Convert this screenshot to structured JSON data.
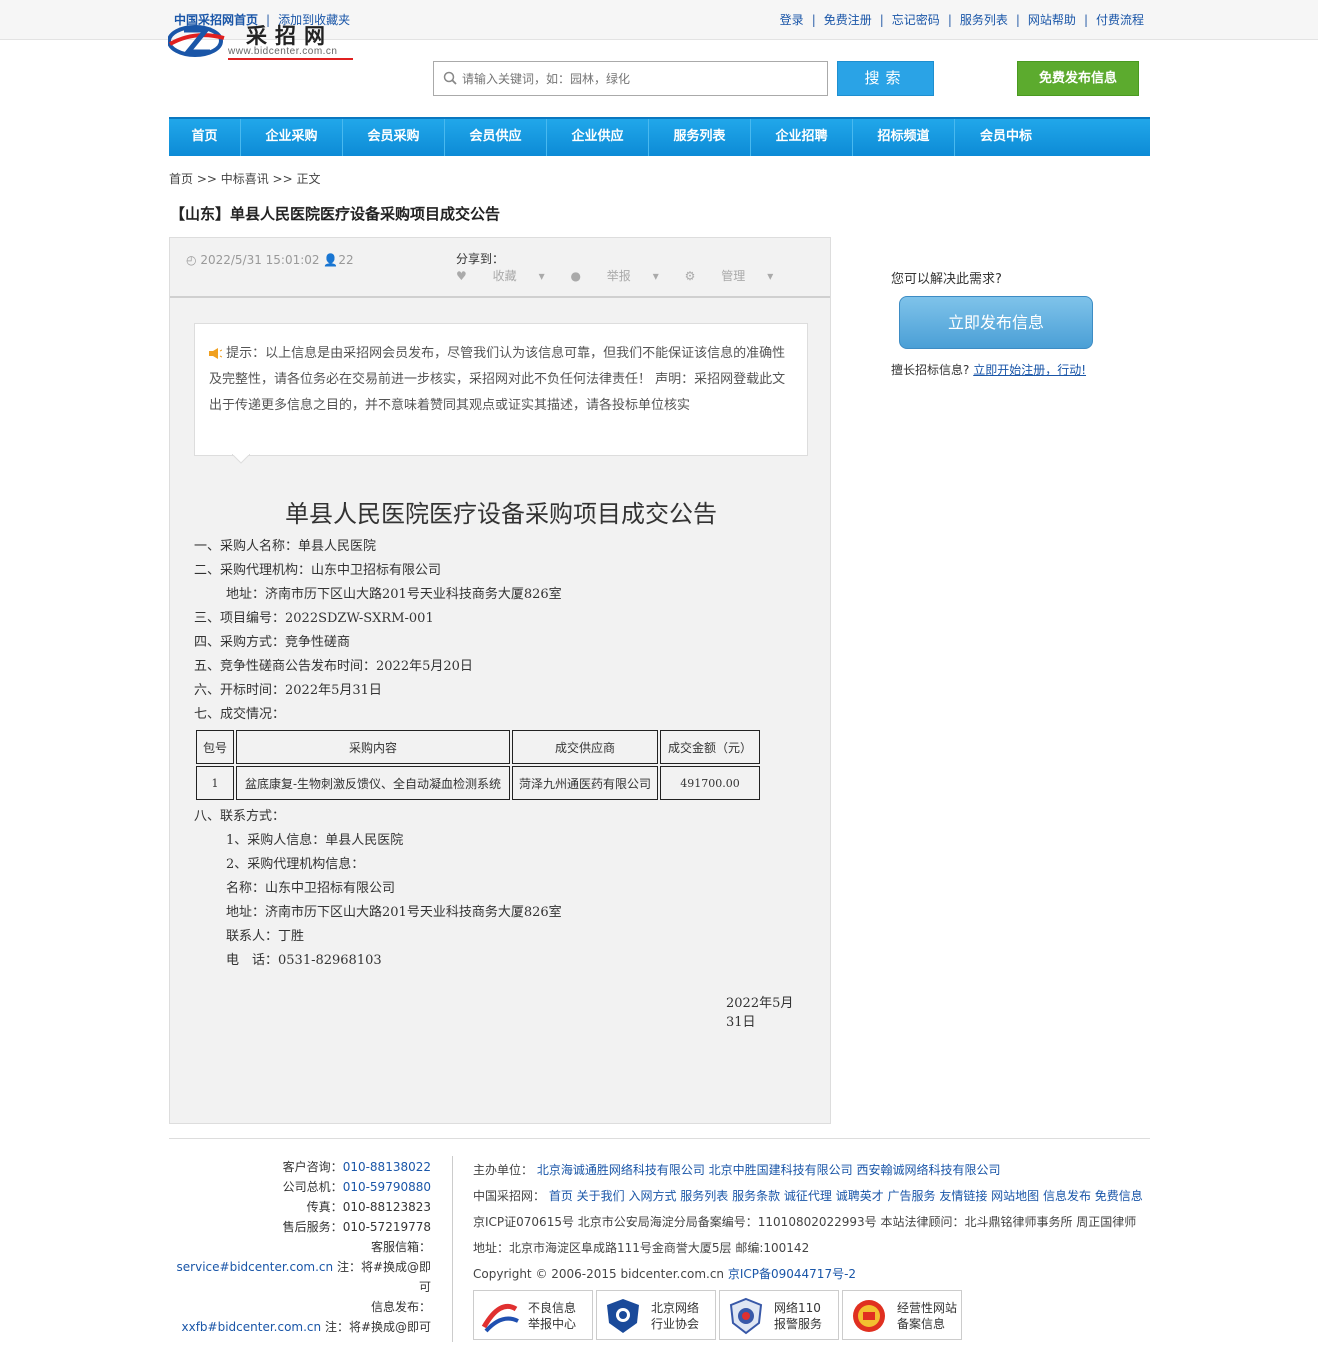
{
  "topbar": {
    "home": "中国采招网首页",
    "fav": "添加到收藏夹",
    "links": [
      "登录",
      "免费注册",
      "忘记密码",
      "服务列表",
      "网站帮助",
      "付费流程"
    ]
  },
  "logo": {
    "title": "采招网",
    "url": "www.bidcenter.com.cn"
  },
  "search": {
    "placeholder": "请输入关键词，如：园林，绿化",
    "button": "搜索"
  },
  "publish_button": "免费发布信息",
  "nav": [
    "首页",
    "企业采购",
    "会员采购",
    "会员供应",
    "企业供应",
    "服务列表",
    "企业招聘",
    "招标频道",
    "会员中标"
  ],
  "breadcrumb": "首页 >> 中标喜讯 >> 正文",
  "title": "【山东】单县人民医院医疗设备采购项目成交公告",
  "meta": {
    "datetime": "2022/5/31 15:01:02",
    "views": "22",
    "share_label": "分享到：",
    "actions": [
      "收藏",
      "举报",
      "管理"
    ]
  },
  "notice": "提示：以上信息是由采招网会员发布，尽管我们认为该信息可靠，但我们不能保证该信息的准确性及完整性，请各位务必在交易前进一步核实，采招网对此不负任何法律责任！ 声明：采招网登载此文出于传递更多信息之目的，并不意味着赞同其观点或证实其描述，请各投标单位核实",
  "article": {
    "heading": "单县人民医院医疗设备采购项目成交公告",
    "lines": [
      {
        "t": "一、采购人名称：单县人民医院",
        "ind": false
      },
      {
        "t": "二、采购代理机构：山东中卫招标有限公司",
        "ind": false
      },
      {
        "t": "地址：济南市历下区山大路201号天业科技商务大厦826室",
        "ind": true
      },
      {
        "t": "三、项目编号：2022SDZW-SXRM-001",
        "ind": false
      },
      {
        "t": "四、采购方式：竞争性磋商",
        "ind": false
      },
      {
        "t": "五、竞争性磋商公告发布时间：2022年5月20日",
        "ind": false
      },
      {
        "t": "六、开标时间：2022年5月31日",
        "ind": false
      },
      {
        "t": "七、成交情况：",
        "ind": false
      }
    ],
    "table": {
      "headers": [
        "包号",
        "采购内容",
        "成交供应商",
        "成交金额（元）"
      ],
      "rows": [
        [
          "1",
          "盆底康复-生物刺激反馈仪、全自动凝血检测系统",
          "菏泽九州通医药有限公司",
          "491700.00"
        ]
      ]
    },
    "lines2": [
      {
        "t": "八、联系方式：",
        "ind": false
      },
      {
        "t": "1、采购人信息：单县人民医院",
        "ind": true
      },
      {
        "t": "2、采购代理机构信息：",
        "ind": true
      },
      {
        "t": "名称：山东中卫招标有限公司",
        "ind": true
      },
      {
        "t": "地址：济南市历下区山大路201号天业科技商务大厦826室",
        "ind": true
      },
      {
        "t": "联系人：丁胜",
        "ind": true
      },
      {
        "t": "电　话：0531-82968103",
        "ind": true
      }
    ],
    "date": "2022年5月31日"
  },
  "side": {
    "question": "您可以解决此需求?",
    "button": "立即发布信息",
    "reg_text": "擅长招标信息?",
    "reg_link": "立即开始注册，行动!"
  },
  "footer_left": [
    {
      "k": "客户咨询：",
      "v": "010-88138022"
    },
    {
      "k": "公司总机：",
      "v": "010-59790880"
    },
    {
      "k": "传真：",
      "v": "010-88123823"
    },
    {
      "k": "售后服务：",
      "v": "010-57219778"
    },
    {
      "k": "客服信箱：",
      "v": ""
    },
    {
      "k": "",
      "v": "service#bidcenter.com.cn",
      "n": " 注：将#换成@即可"
    },
    {
      "k": "信息发布：",
      "v": ""
    },
    {
      "k": "",
      "v": "xxfb#bidcenter.com.cn",
      "n": " 注：将#换成@即可"
    }
  ],
  "footer_right": {
    "host_label": "主办单位：",
    "hosts": "北京海诚通胜网络科技有限公司 北京中胜国建科技有限公司 西安翰诚网络科技有限公司",
    "links_label": "中国采招网：",
    "links": "首页 关于我们 入网方式 服务列表 服务条款 诚征代理 诚聘英才 广告服务 友情链接 网站地图 信息发布 免费信息",
    "icp": "京ICP证070615号 北京市公安局海淀分局备案编号：11010802022993号 本站法律顾问：北斗鼎铭律师事务所 周正国律师",
    "address": "地址：北京市海淀区阜成路111号金商誉大厦5层 邮编:100142",
    "copyright": "Copyright © 2006-2015 bidcenter.com.cn ",
    "icp2": "京ICP备09044717号-2"
  },
  "badges": [
    [
      "不良信息",
      "举报中心"
    ],
    [
      "北京网络",
      "行业协会"
    ],
    [
      "网络110",
      "报警服务"
    ],
    [
      "经营性网站",
      "备案信息"
    ]
  ]
}
